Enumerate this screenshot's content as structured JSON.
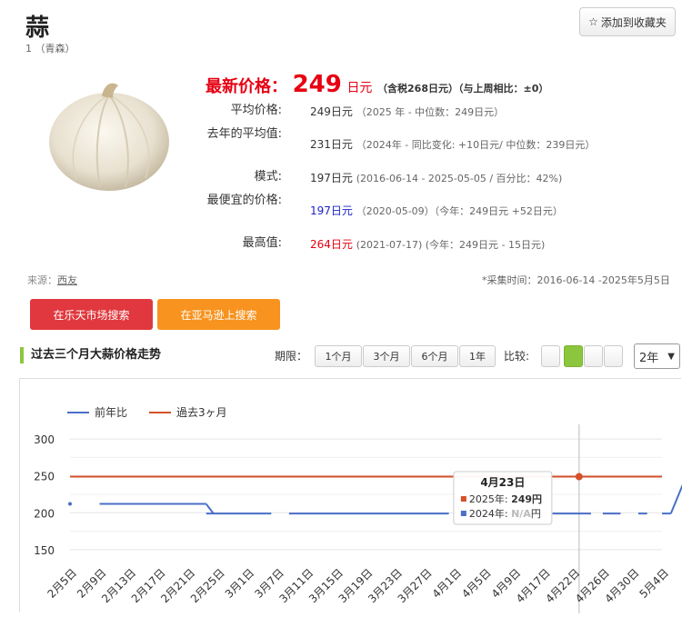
{
  "product": {
    "name": "蒜",
    "subtitle": "1 （青森）"
  },
  "favorite": {
    "label": "添加到收藏夹"
  },
  "price": {
    "latest_label": "最新价格：",
    "latest_value": "249",
    "latest_unit": "日元",
    "tax_note": "（含税268日元）（与上周相比：±0）",
    "rows": [
      {
        "label": "平均价格:",
        "value": "249日元",
        "note": "（2025 年 - 中位数：249日元）"
      },
      {
        "label": "去年的平均值:",
        "value": "231日元",
        "note_a": "（2024年 - 同比变化: ",
        "note_red": "+10日元",
        "note_b": "/ 中位数：239日元）"
      },
      {
        "label": "模式:",
        "value": "197日元",
        "note": "(2016-06-14 - 2025-05-05 / 百分比：42%)"
      },
      {
        "label": "最便宜的价格:",
        "value": "197日元",
        "note_a": "（2020-05-09）（今年：249日元 ",
        "note_red": "+52日元",
        "note_b": "）"
      },
      {
        "label": "最高值:",
        "value": "264日元",
        "note_a": "(2021-07-17) (今年：249日元 - ",
        "note_blue": "15日元",
        "note_b": ")"
      }
    ]
  },
  "source": {
    "label": "来源：",
    "link": "西友"
  },
  "collect_time": "*采集时间：2016-06-14 -2025年5月5日",
  "buttons": {
    "rakuten": "在乐天市场搜索",
    "amazon": "在亚马逊上搜索"
  },
  "trend": {
    "title": "过去三个月大蒜价格走势",
    "period_label": "期限：",
    "periods": [
      "1个月",
      "3个月",
      "6个月",
      "1年"
    ],
    "compare_label": "比较:",
    "select_value": "2年"
  },
  "colors": {
    "accent_red": "#e60012",
    "green": "#8cc63f",
    "series_blue": "#4a6fc9",
    "series_red": "#d4502a"
  },
  "chart_data": {
    "type": "line",
    "legend": [
      {
        "name": "前年比",
        "color": "#4a6fc9"
      },
      {
        "name": "過去3ヶ月",
        "color": "#d4502a"
      }
    ],
    "y_ticks": [
      150,
      200,
      250,
      300
    ],
    "ylim": [
      140,
      310
    ],
    "x_labels": [
      "2月5日",
      "2月9日",
      "2月13日",
      "2月17日",
      "2月21日",
      "2月25日",
      "3月1日",
      "3月7日",
      "3月11日",
      "3月15日",
      "3月19日",
      "3月23日",
      "3月27日",
      "4月1日",
      "4月5日",
      "4月9日",
      "4月17日",
      "4月22日",
      "4月26日",
      "4月30日",
      "5月4日"
    ],
    "series_red": {
      "name": "過去3ヶ月",
      "value": 249
    },
    "series_blue_segments": [
      {
        "from": 0,
        "to": 0,
        "value": 212
      },
      {
        "from": 1,
        "to": 4.6,
        "value": 212
      },
      {
        "from": 4.6,
        "to": 6.8,
        "value": 199
      },
      {
        "from": 7.4,
        "to": 12.8,
        "value": 199
      },
      {
        "from": 13.2,
        "to": 15.8,
        "value": 199
      },
      {
        "from": 16.3,
        "to": 17.6,
        "value": 199
      },
      {
        "from": 18,
        "to": 18.6,
        "value": 199
      },
      {
        "from": 19.2,
        "to": 19.5,
        "value": 199
      },
      {
        "from": 20,
        "to": 20.3,
        "value": 199
      },
      {
        "from": 20.3,
        "to": 20.7,
        "value": 238
      }
    ],
    "tooltip": {
      "title": "4月23日",
      "row1_label": "2025年: ",
      "row1_value": "249円",
      "row2_label": "2024年: ",
      "row2_value": "N/A",
      "row2_unit": "円",
      "index": 17.2,
      "value": 249
    }
  }
}
